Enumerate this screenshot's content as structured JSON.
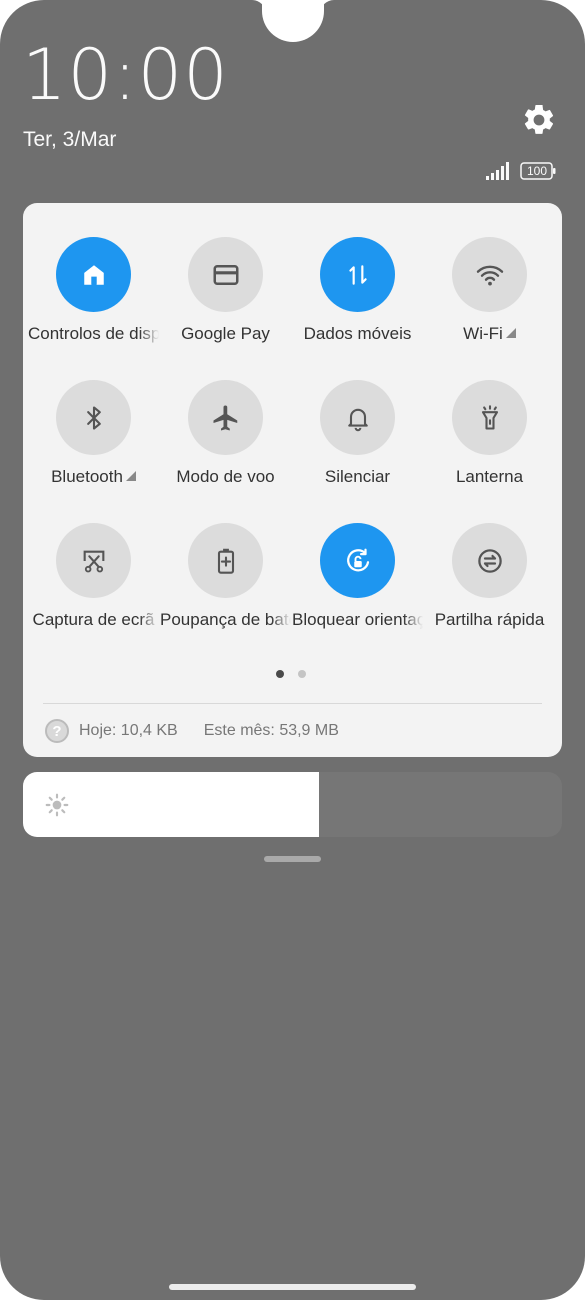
{
  "status": {
    "time": "10:00",
    "date": "Ter, 3/Mar",
    "battery": "100"
  },
  "quick_settings": {
    "tiles": [
      {
        "label": "Controlos de dispositivos",
        "icon": "home-icon",
        "active": true
      },
      {
        "label": "Google Pay",
        "icon": "card-icon",
        "active": false
      },
      {
        "label": "Dados móveis",
        "icon": "data-arrows-icon",
        "active": true
      },
      {
        "label": "Wi-Fi",
        "icon": "wifi-icon",
        "active": false,
        "expand": true
      },
      {
        "label": "Bluetooth",
        "icon": "bluetooth-icon",
        "active": false,
        "expand": true
      },
      {
        "label": "Modo de voo",
        "icon": "airplane-icon",
        "active": false
      },
      {
        "label": "Silenciar",
        "icon": "bell-icon",
        "active": false
      },
      {
        "label": "Lanterna",
        "icon": "flashlight-icon",
        "active": false
      },
      {
        "label": "Captura de ecrã",
        "icon": "screenshot-icon",
        "active": false
      },
      {
        "label": "Poupança de bateria",
        "icon": "battery-saver-icon",
        "active": false
      },
      {
        "label": "Bloquear orientação",
        "icon": "rotation-lock-icon",
        "active": true
      },
      {
        "label": "Partilha rápida",
        "icon": "quick-share-icon",
        "active": false
      }
    ],
    "page_count": 2,
    "current_page": 1
  },
  "data_usage": {
    "today": "Hoje: 10,4 KB",
    "month": "Este mês: 53,9 MB"
  },
  "brightness": {
    "level": 0.55
  },
  "colors": {
    "accent": "#1e96f0",
    "background": "#6f6f6f",
    "panel": "#f3f3f3",
    "tile_off": "#dcdcdc"
  }
}
